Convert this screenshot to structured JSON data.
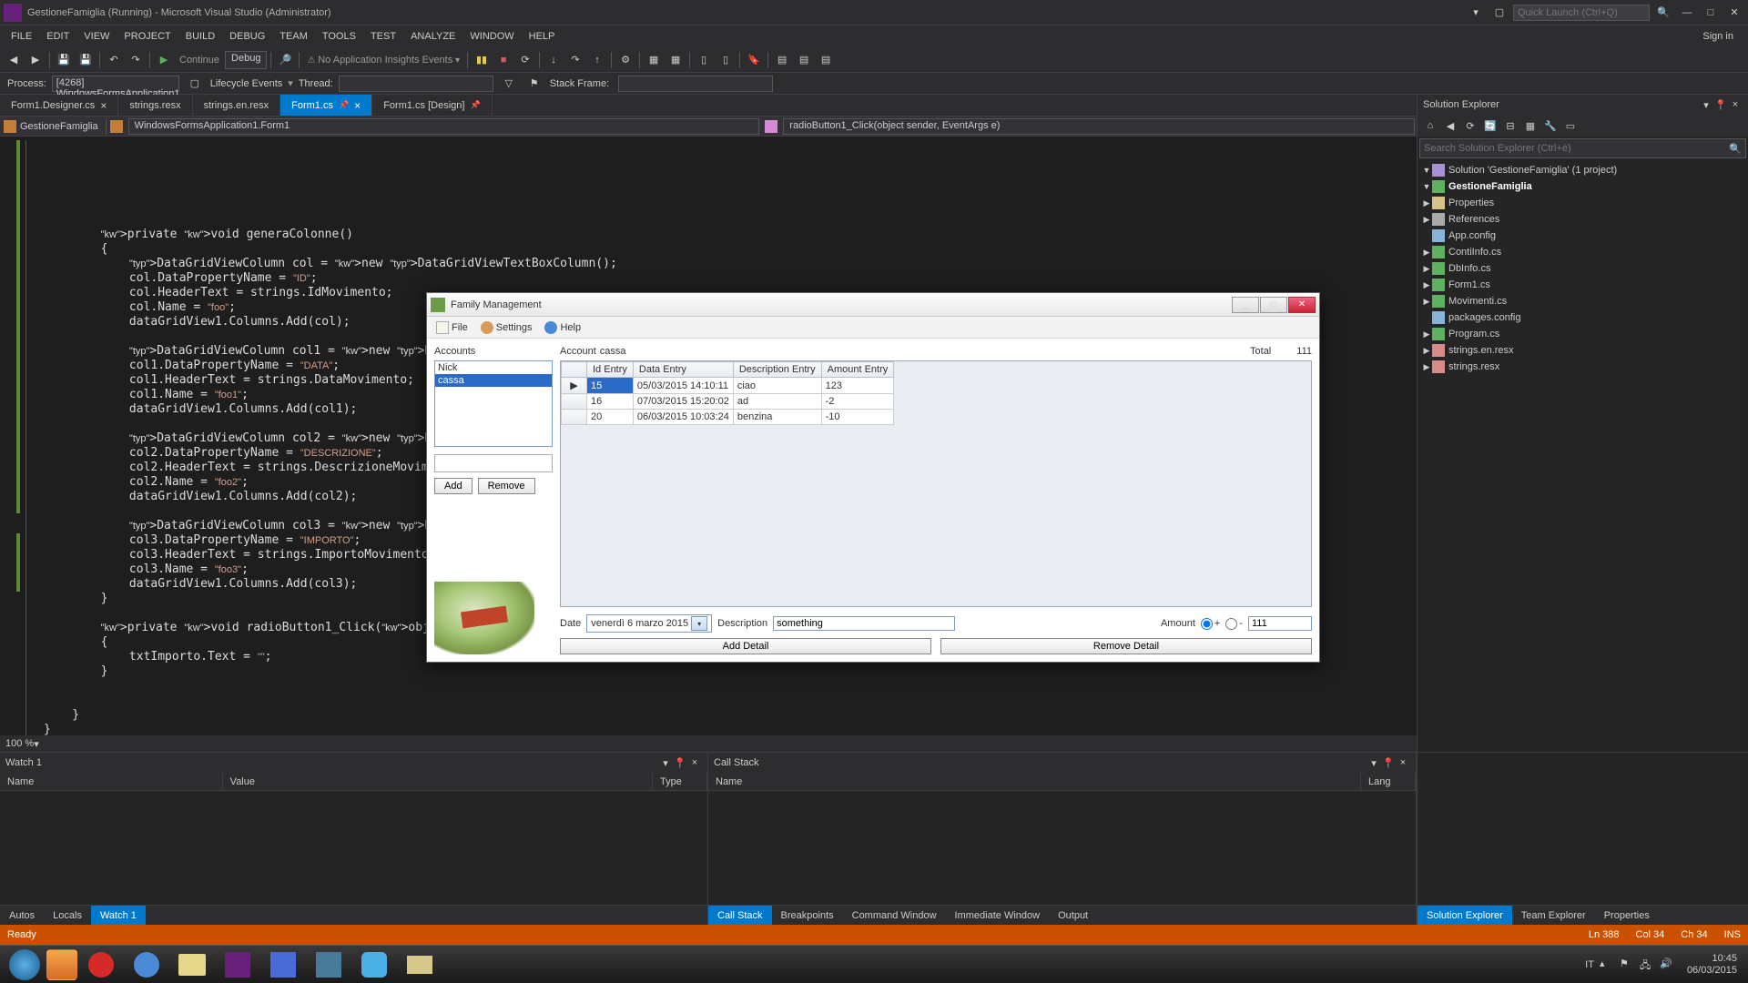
{
  "titlebar": {
    "title": "GestioneFamiglia (Running) - Microsoft Visual Studio (Administrator)",
    "quicklaunch_ph": "Quick Launch (Ctrl+Q)"
  },
  "menu": [
    "FILE",
    "EDIT",
    "VIEW",
    "PROJECT",
    "BUILD",
    "DEBUG",
    "TEAM",
    "TOOLS",
    "TEST",
    "ANALYZE",
    "WINDOW",
    "HELP"
  ],
  "signin": "Sign in",
  "toolbar": {
    "continue": "Continue",
    "config": "Debug",
    "ai": "No Application Insights Events"
  },
  "debugbar": {
    "process_lbl": "Process:",
    "process_val": "[4268] WindowsFormsApplication1",
    "lifecycle": "Lifecycle Events",
    "thread_lbl": "Thread:",
    "stackframe_lbl": "Stack Frame:"
  },
  "tabs": [
    {
      "label": "Form1.Designer.cs",
      "active": false,
      "closable": true
    },
    {
      "label": "strings.resx",
      "active": false,
      "closable": false
    },
    {
      "label": "strings.en.resx",
      "active": false,
      "closable": false
    },
    {
      "label": "Form1.cs",
      "active": true,
      "pinned": true,
      "closable": true
    },
    {
      "label": "Form1.cs [Design]",
      "active": false,
      "pinned": true,
      "closable": false
    }
  ],
  "navbar": {
    "left": "GestioneFamiglia",
    "mid": "WindowsFormsApplication1.Form1",
    "right": "radioButton1_Click(object sender, EventArgs e)"
  },
  "code": "        private void generaColonne()\n        {\n            DataGridViewColumn col = new DataGridViewTextBoxColumn();\n            col.DataPropertyName = \"ID\";\n            col.HeaderText = strings.IdMovimento;\n            col.Name = \"foo\";\n            dataGridView1.Columns.Add(col);\n\n            DataGridViewColumn col1 = new DataGridViewTextBoxColumn();\n            col1.DataPropertyName = \"DATA\";\n            col1.HeaderText = strings.DataMovimento;\n            col1.Name = \"foo1\";\n            dataGridView1.Columns.Add(col1);\n\n            DataGridViewColumn col2 = new DataGridViewTextBoxColumn();\n            col2.DataPropertyName = \"DESCRIZIONE\";\n            col2.HeaderText = strings.DescrizioneMovimento;\n            col2.Name = \"foo2\";\n            dataGridView1.Columns.Add(col2);\n\n            DataGridViewColumn col3 = new DataGridViewTextBoxColumn();\n            col3.DataPropertyName = \"IMPORTO\";\n            col3.HeaderText = strings.ImportoMovimento;\n            col3.Name = \"foo3\";\n            dataGridView1.Columns.Add(col3);\n        }\n\n        private void radioButton1_Click(object sender, EventArgs e)\n        {\n            txtImporto.Text = \"\";\n        }\n\n\n    }\n}",
  "zoom": "100 %",
  "se": {
    "title": "Solution Explorer",
    "search_ph": "Search Solution Explorer (Ctrl+è)",
    "nodes": [
      {
        "indent": 0,
        "icon": "ic-sol",
        "label": "Solution 'GestioneFamiglia' (1 project)",
        "arrow": "▼"
      },
      {
        "indent": 1,
        "icon": "ic-proj",
        "label": "GestioneFamiglia",
        "arrow": "▼",
        "bold": true
      },
      {
        "indent": 2,
        "icon": "ic-fold",
        "label": "Properties",
        "arrow": "▶"
      },
      {
        "indent": 2,
        "icon": "ic-ref",
        "label": "References",
        "arrow": "▶"
      },
      {
        "indent": 2,
        "icon": "ic-conf",
        "label": "App.config",
        "arrow": ""
      },
      {
        "indent": 2,
        "icon": "ic-cs",
        "label": "ContiInfo.cs",
        "arrow": "▶"
      },
      {
        "indent": 2,
        "icon": "ic-cs",
        "label": "DbInfo.cs",
        "arrow": "▶"
      },
      {
        "indent": 2,
        "icon": "ic-cs",
        "label": "Form1.cs",
        "arrow": "▶"
      },
      {
        "indent": 2,
        "icon": "ic-cs",
        "label": "Movimenti.cs",
        "arrow": "▶"
      },
      {
        "indent": 2,
        "icon": "ic-conf",
        "label": "packages.config",
        "arrow": ""
      },
      {
        "indent": 2,
        "icon": "ic-cs",
        "label": "Program.cs",
        "arrow": "▶"
      },
      {
        "indent": 2,
        "icon": "ic-resx",
        "label": "strings.en.resx",
        "arrow": "▶"
      },
      {
        "indent": 2,
        "icon": "ic-resx",
        "label": "strings.resx",
        "arrow": "▶"
      }
    ]
  },
  "watch": {
    "title": "Watch 1",
    "cols": [
      "Name",
      "Value",
      "Type"
    ],
    "tabs": [
      "Autos",
      "Locals",
      "Watch 1"
    ],
    "active_tab": "Watch 1"
  },
  "callstack": {
    "title": "Call Stack",
    "cols": [
      "Name",
      "Lang"
    ],
    "tabs": [
      "Call Stack",
      "Breakpoints",
      "Command Window",
      "Immediate Window",
      "Output"
    ],
    "active_tab": "Call Stack"
  },
  "side_tabs": [
    "Solution Explorer",
    "Team Explorer",
    "Properties"
  ],
  "side_active": "Solution Explorer",
  "status": {
    "ready": "Ready",
    "ln": "Ln 388",
    "col": "Col 34",
    "ch": "Ch 34",
    "ins": "INS"
  },
  "dialog": {
    "title": "Family Management",
    "menu": {
      "file": "File",
      "settings": "Settings",
      "help": "Help"
    },
    "accounts_lbl": "Accounts",
    "accounts": [
      "Nick",
      "cassa"
    ],
    "accounts_sel": "cassa",
    "add_btn": "Add",
    "remove_btn": "Remove",
    "account_lbl": "Account",
    "account_val": "cassa",
    "total_lbl": "Total",
    "total_val": "111",
    "grid_cols": [
      "Id Entry",
      "Data Entry",
      "Description Entry",
      "Amount Entry"
    ],
    "grid_rows": [
      {
        "id": "15",
        "date": "05/03/2015 14:10:11",
        "desc": "ciao",
        "amt": "123",
        "current": true
      },
      {
        "id": "16",
        "date": "07/03/2015 15:20:02",
        "desc": "ad",
        "amt": "-2",
        "current": false
      },
      {
        "id": "20",
        "date": "06/03/2015 10:03:24",
        "desc": "benzina",
        "amt": "-10",
        "current": false
      }
    ],
    "date_lbl": "Date",
    "date_val": {
      "dow": "venerdì",
      "d": "6",
      "m": "marzo",
      "y": "2015"
    },
    "desc_lbl": "Description",
    "desc_val": "something",
    "amount_lbl": "Amount",
    "amount_plus": "+",
    "amount_minus": "-",
    "amount_val": "111",
    "add_detail": "Add Detail",
    "remove_detail": "Remove Detail"
  },
  "tray": {
    "lang": "IT",
    "time": "10:45",
    "date": "06/03/2015"
  }
}
